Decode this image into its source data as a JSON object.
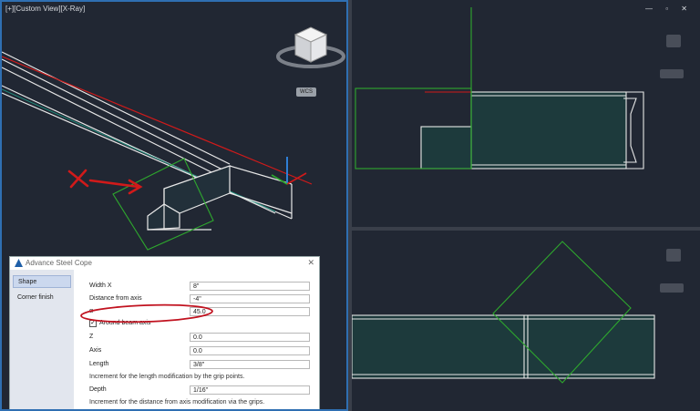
{
  "viewport_left": {
    "label": "[+][Custom View][X-Ray]",
    "wcs_label": "WCS"
  },
  "window_controls": "— ▫ ✕",
  "dialog": {
    "title": "Advance Steel   Cope",
    "close_glyph": "✕",
    "sidebar": [
      "Shape",
      "Corner finish"
    ],
    "fields": [
      {
        "label": "Width X",
        "value": "8\""
      },
      {
        "label": "Distance from axis",
        "value": "-4\""
      },
      {
        "label": "α",
        "value": "45.0"
      }
    ],
    "around_beam_axis": {
      "label": "Around beam axis",
      "checked": "✓"
    },
    "fields2": [
      {
        "label": "Z",
        "value": "0.0"
      },
      {
        "label": "Axis",
        "value": "0.0"
      },
      {
        "label": "Length",
        "value": "3/8\""
      }
    ],
    "note_length": "Increment for the length modification by the grip points.",
    "depth": {
      "label": "Depth",
      "value": "1/16\""
    },
    "note_depth": "Increment for the distance from axis modification via the grips."
  },
  "colors": {
    "accent_blue": "#2f6fb2",
    "annotation_red": "#d11a1a",
    "cut_green": "#2ea82e",
    "beam_fill": "#1d3a3c"
  }
}
